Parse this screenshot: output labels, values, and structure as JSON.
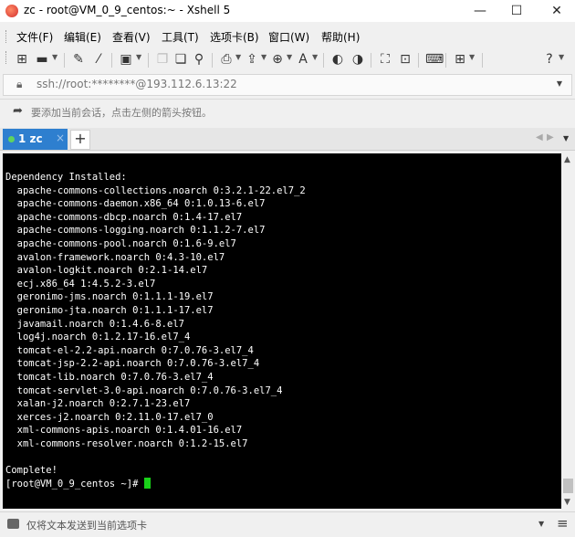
{
  "window": {
    "title": "zc - root@VM_0_9_centos:~ - Xshell 5",
    "minimize": "—",
    "maximize": "☐",
    "close": "✕"
  },
  "menu": [
    "文件(F)",
    "编辑(E)",
    "查看(V)",
    "工具(T)",
    "选项卡(B)",
    "窗口(W)",
    "帮助(H)"
  ],
  "toolbar": {
    "icons": [
      "new-session-icon",
      "open-folder-icon",
      "connect-icon",
      "disconnect-icon",
      "properties-icon",
      "copy-icon",
      "paste-icon",
      "find-icon",
      "print-icon",
      "transfer-icon",
      "globe-icon",
      "font-icon",
      "xftp-icon",
      "xmanager-icon",
      "fullscreen-icon",
      "lock-icon",
      "keyboard-icon",
      "add-icon",
      "help-icon"
    ]
  },
  "address": {
    "value": "ssh://root:********@193.112.6.13:22"
  },
  "hint": {
    "text": "要添加当前会话，点击左侧的箭头按钮。"
  },
  "tabs": [
    {
      "label": "1 zc",
      "close": "×",
      "active": true,
      "status_color": "#5fd35f"
    }
  ],
  "tab_add": "+",
  "terminal": {
    "lines": [
      "Dependency Installed:",
      "  apache-commons-collections.noarch 0:3.2.1-22.el7_2",
      "  apache-commons-daemon.x86_64 0:1.0.13-6.el7",
      "  apache-commons-dbcp.noarch 0:1.4-17.el7",
      "  apache-commons-logging.noarch 0:1.1.2-7.el7",
      "  apache-commons-pool.noarch 0:1.6-9.el7",
      "  avalon-framework.noarch 0:4.3-10.el7",
      "  avalon-logkit.noarch 0:2.1-14.el7",
      "  ecj.x86_64 1:4.5.2-3.el7",
      "  geronimo-jms.noarch 0:1.1.1-19.el7",
      "  geronimo-jta.noarch 0:1.1.1-17.el7",
      "  javamail.noarch 0:1.4.6-8.el7",
      "  log4j.noarch 0:1.2.17-16.el7_4",
      "  tomcat-el-2.2-api.noarch 0:7.0.76-3.el7_4",
      "  tomcat-jsp-2.2-api.noarch 0:7.0.76-3.el7_4",
      "  tomcat-lib.noarch 0:7.0.76-3.el7_4",
      "  tomcat-servlet-3.0-api.noarch 0:7.0.76-3.el7_4",
      "  xalan-j2.noarch 0:2.7.1-23.el7",
      "  xerces-j2.noarch 0:2.11.0-17.el7_0",
      "  xml-commons-apis.noarch 0:1.4.01-16.el7",
      "  xml-commons-resolver.noarch 0:1.2-15.el7",
      "",
      "Complete!"
    ],
    "prompt": "[root@VM_0_9_centos ~]# ",
    "cursor_color": "#19d119"
  },
  "status": {
    "text": "仅将文本发送到当前选项卡"
  },
  "colors": {
    "accent": "#2e7fcf",
    "terminal_bg": "#000000",
    "terminal_fg": "#ffffff"
  }
}
